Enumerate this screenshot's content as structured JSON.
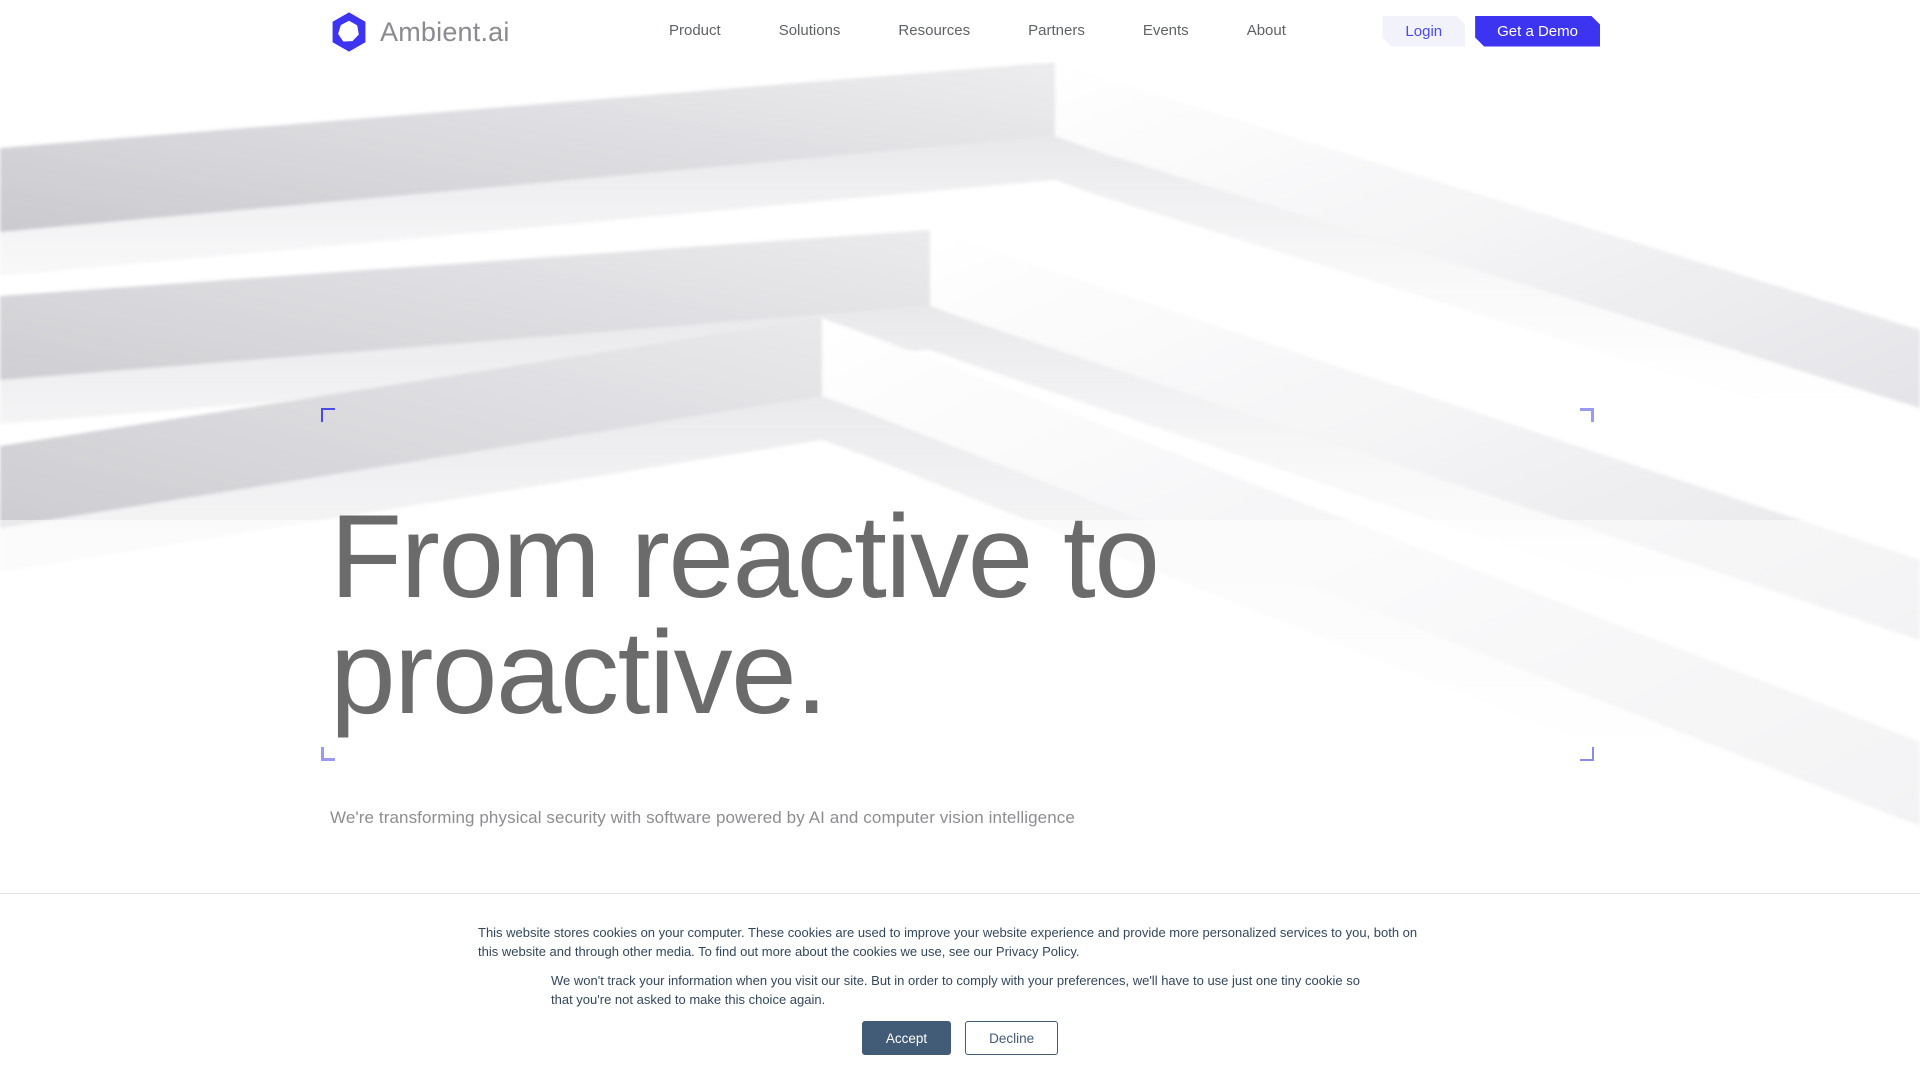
{
  "brand": {
    "name": "Ambient.ai",
    "logo_icon": "hexagon-logo-icon",
    "logo_color": "#3d34f2",
    "wordmark_color": "#8a8a8f"
  },
  "nav": {
    "items": [
      {
        "label": "Product"
      },
      {
        "label": "Solutions"
      },
      {
        "label": "Resources"
      },
      {
        "label": "Partners"
      },
      {
        "label": "Events"
      },
      {
        "label": "About"
      }
    ]
  },
  "header_actions": {
    "login_label": "Login",
    "login_bg": "#f2f2fb",
    "login_color": "#4a4af0",
    "demo_label": "Get a Demo",
    "demo_bg": "#3d34f2",
    "demo_color": "#ffffff"
  },
  "hero": {
    "headline_line1": "From reactive to",
    "headline_line2": "proactive.",
    "subhead": "We're transforming physical security with software powered by AI and computer vision intelligence",
    "headline_color": "#6b6b6b",
    "bracket_color": "#4a4ae8",
    "background_description": "three white 3D chevron ribbons on white"
  },
  "cookie_banner": {
    "paragraph1_part1": "This website stores cookies on your computer. These cookies are used to improve your website experience and provide more personalized services to you, both on this website and through other media. To find out more about the cookies we use, see our ",
    "privacy_link": "Privacy Policy",
    "paragraph1_part2": ".",
    "paragraph2": "We won't track your information when you visit our site. But in order to comply with your preferences, we'll have to use just one tiny cookie so that you're not asked to make this choice again.",
    "accept_label": "Accept",
    "decline_label": "Decline",
    "accept_bg": "#425b76",
    "text_color": "#33475b"
  }
}
